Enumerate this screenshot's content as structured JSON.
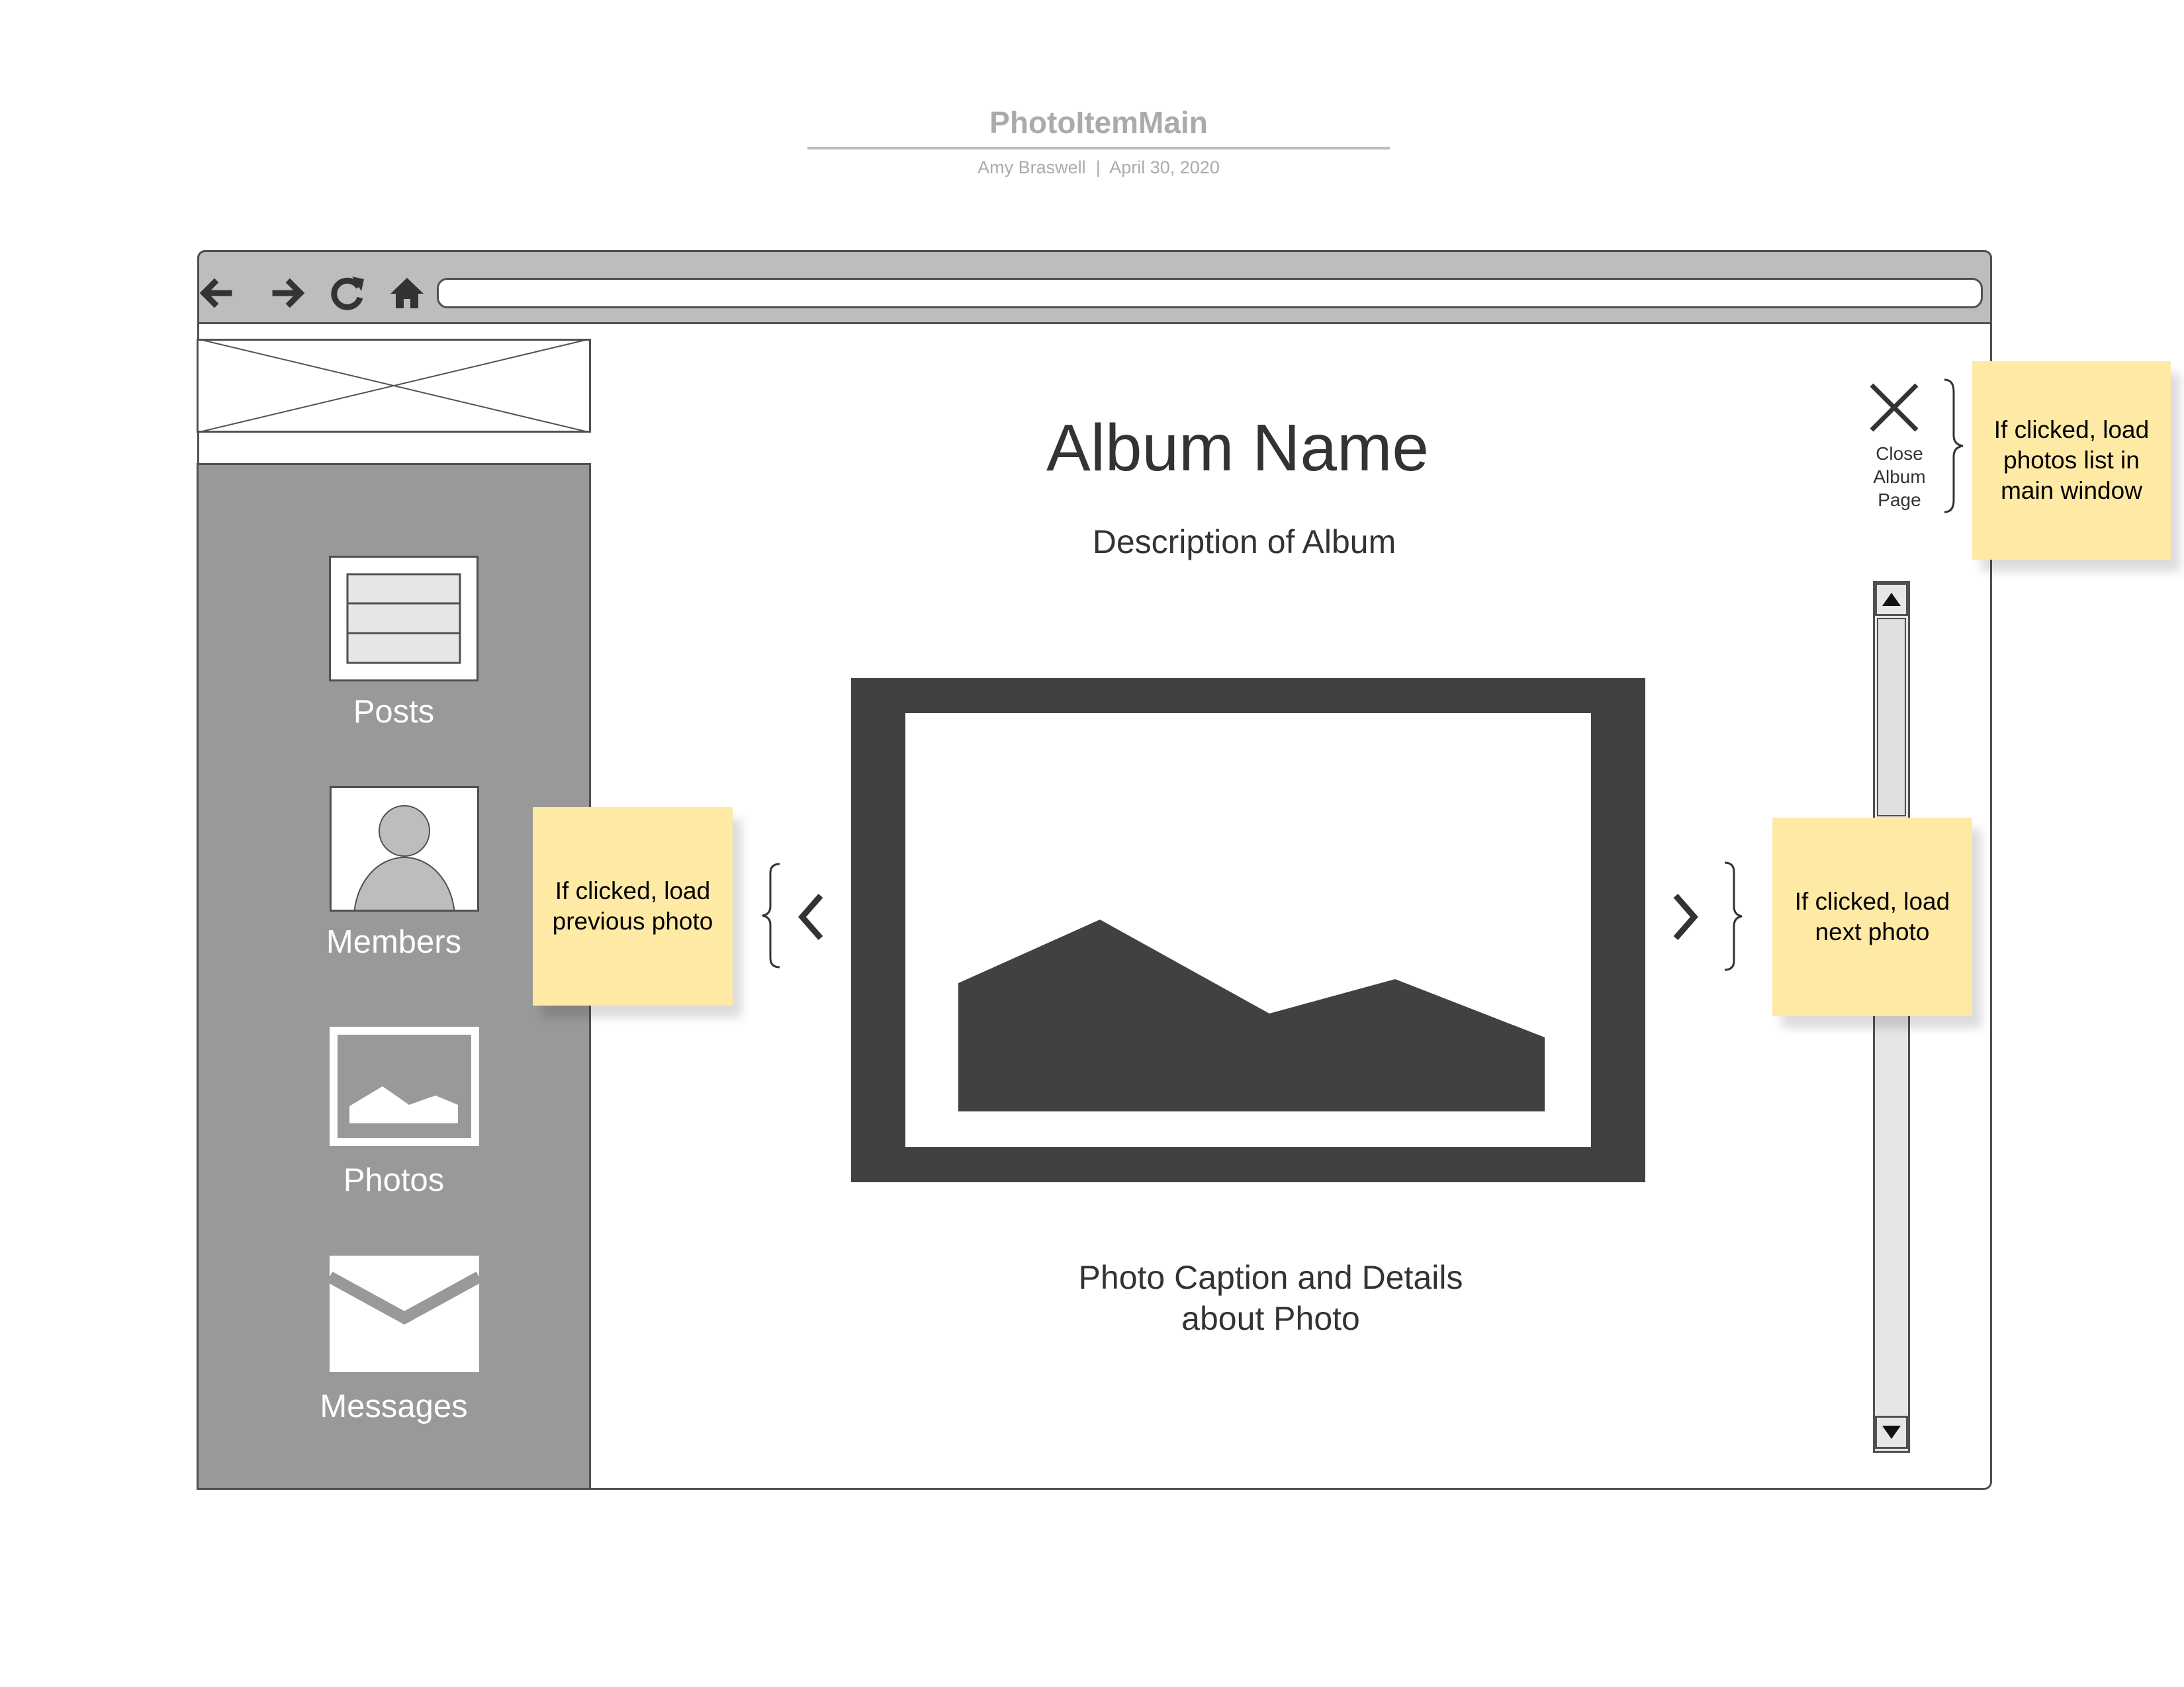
{
  "document": {
    "title": "PhotoItemMain",
    "author": "Amy Braswell",
    "separator": "|",
    "date": "April 30, 2020"
  },
  "browser": {
    "nav_icons": [
      "back-arrow-icon",
      "forward-arrow-icon",
      "refresh-icon",
      "home-icon"
    ],
    "url_value": ""
  },
  "sidebar": {
    "items": [
      {
        "label": "Posts",
        "icon": "posts-icon"
      },
      {
        "label": "Members",
        "icon": "member-avatar-icon"
      },
      {
        "label": "Photos",
        "icon": "photo-icon"
      },
      {
        "label": "Messages",
        "icon": "envelope-icon"
      }
    ]
  },
  "main": {
    "album_name": "Album Name",
    "album_description": "Description of Album",
    "caption_line1": "Photo Caption and Details",
    "caption_line2": "about Photo",
    "close": {
      "line1": "Close",
      "line2": "Album",
      "line3": "Page",
      "icon": "close-icon"
    },
    "prev_icon": "chevron-left-icon",
    "next_icon": "chevron-right-icon"
  },
  "notes": {
    "close": "If clicked, load photos list in main window",
    "prev": "If clicked, load previous photo",
    "next": "If clicked, load next photo"
  },
  "colors": {
    "sidebar": "#999999",
    "toolbar": "#bdbdbd",
    "photo_frame": "#424041",
    "sticky_note": "#fee9a5",
    "text_dark": "#333333"
  }
}
